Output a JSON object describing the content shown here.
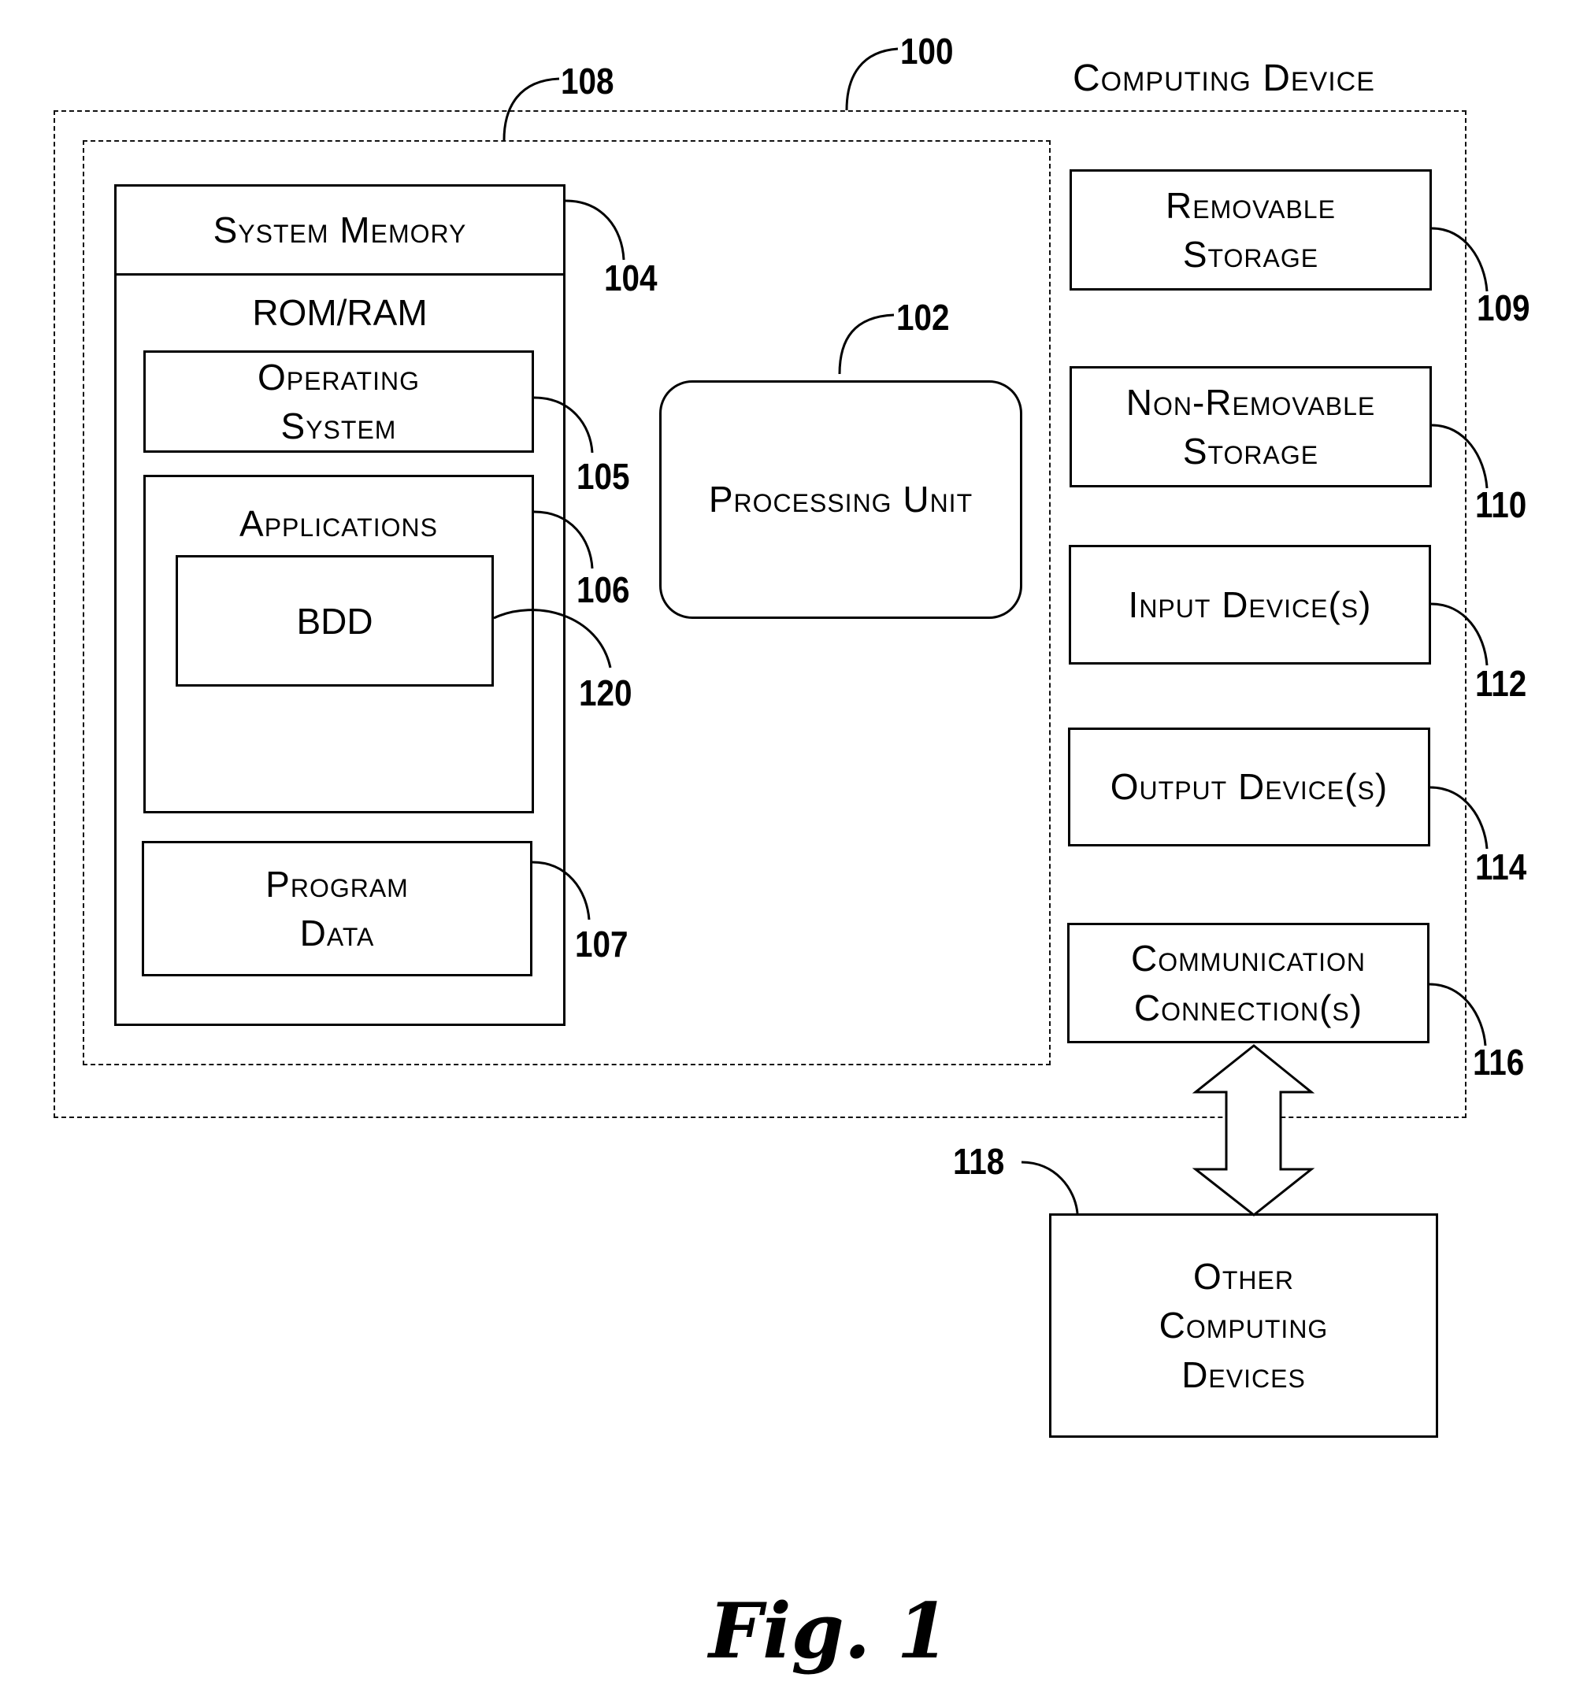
{
  "figure": {
    "caption": "Fig. 1",
    "device_title": "Computing Device"
  },
  "refs": {
    "computing_device": "100",
    "processing_unit": "102",
    "system_memory": "104",
    "operating_system": "105",
    "applications": "106",
    "program_data": "107",
    "basic_config": "108",
    "removable_storage": "109",
    "non_removable_storage": "110",
    "input_devices": "112",
    "output_devices": "114",
    "communication_connections": "116",
    "other_computing_devices": "118",
    "bdd": "120"
  },
  "memory": {
    "header": "System Memory",
    "subheader": "ROM/RAM",
    "operating_system": [
      "Operating",
      "System"
    ],
    "applications": "Applications",
    "bdd": "BDD",
    "program_data": [
      "Program",
      "Data"
    ]
  },
  "processing_unit": "Processing Unit",
  "peripherals": {
    "removable_storage": [
      "Removable",
      "Storage"
    ],
    "non_removable_storage": [
      "Non-Removable",
      "Storage"
    ],
    "input_devices": "Input Device(s)",
    "output_devices": "Output Device(s)",
    "communication_connections": [
      "Communication",
      "Connection(s)"
    ]
  },
  "other_devices": [
    "Other",
    "Computing",
    "Devices"
  ]
}
